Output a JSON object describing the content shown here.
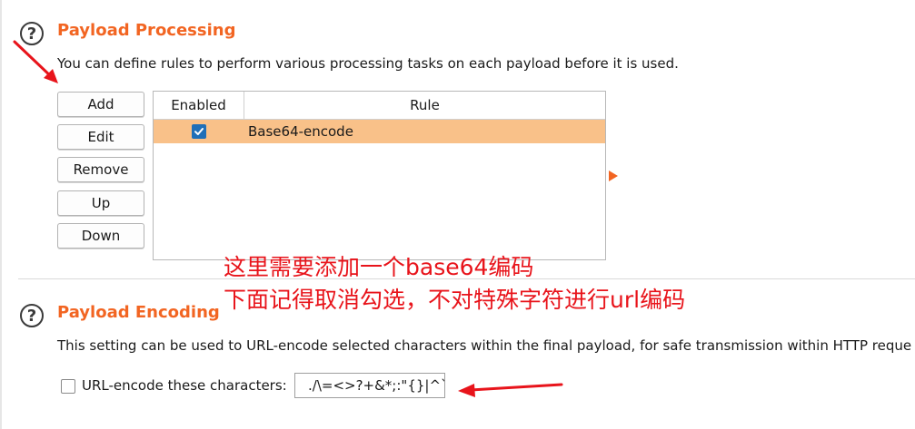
{
  "payload_processing": {
    "title": "Payload Processing",
    "description": "You can define rules to perform various processing tasks on each payload before it is used.",
    "buttons": {
      "add": "Add",
      "edit": "Edit",
      "remove": "Remove",
      "up": "Up",
      "down": "Down"
    },
    "table": {
      "columns": [
        "Enabled",
        "Rule"
      ],
      "rows": [
        {
          "enabled": true,
          "rule": "Base64-encode",
          "selected": true
        }
      ]
    }
  },
  "payload_encoding": {
    "title": "Payload Encoding",
    "description": "This setting can be used to URL-encode selected characters within the final payload, for safe transmission within HTTP reque",
    "checkbox_label": "URL-encode these characters:",
    "checkbox_checked": false,
    "characters": "./\\=<>?+&*;:\"{}|^`"
  },
  "annotations": {
    "line1": "这里需要添加一个base64编码",
    "line2": "下面记得取消勾选，不对特殊字符进行url编码"
  },
  "icons": {
    "help": "help-circle-icon",
    "checkmark": "checkmark-icon",
    "expand_arrow": "triangle-right-icon"
  },
  "colors": {
    "accent": "#f26522",
    "selected_row": "#f9c189",
    "checkbox_checked": "#1f6fb8",
    "annotation": "#e8141b"
  }
}
